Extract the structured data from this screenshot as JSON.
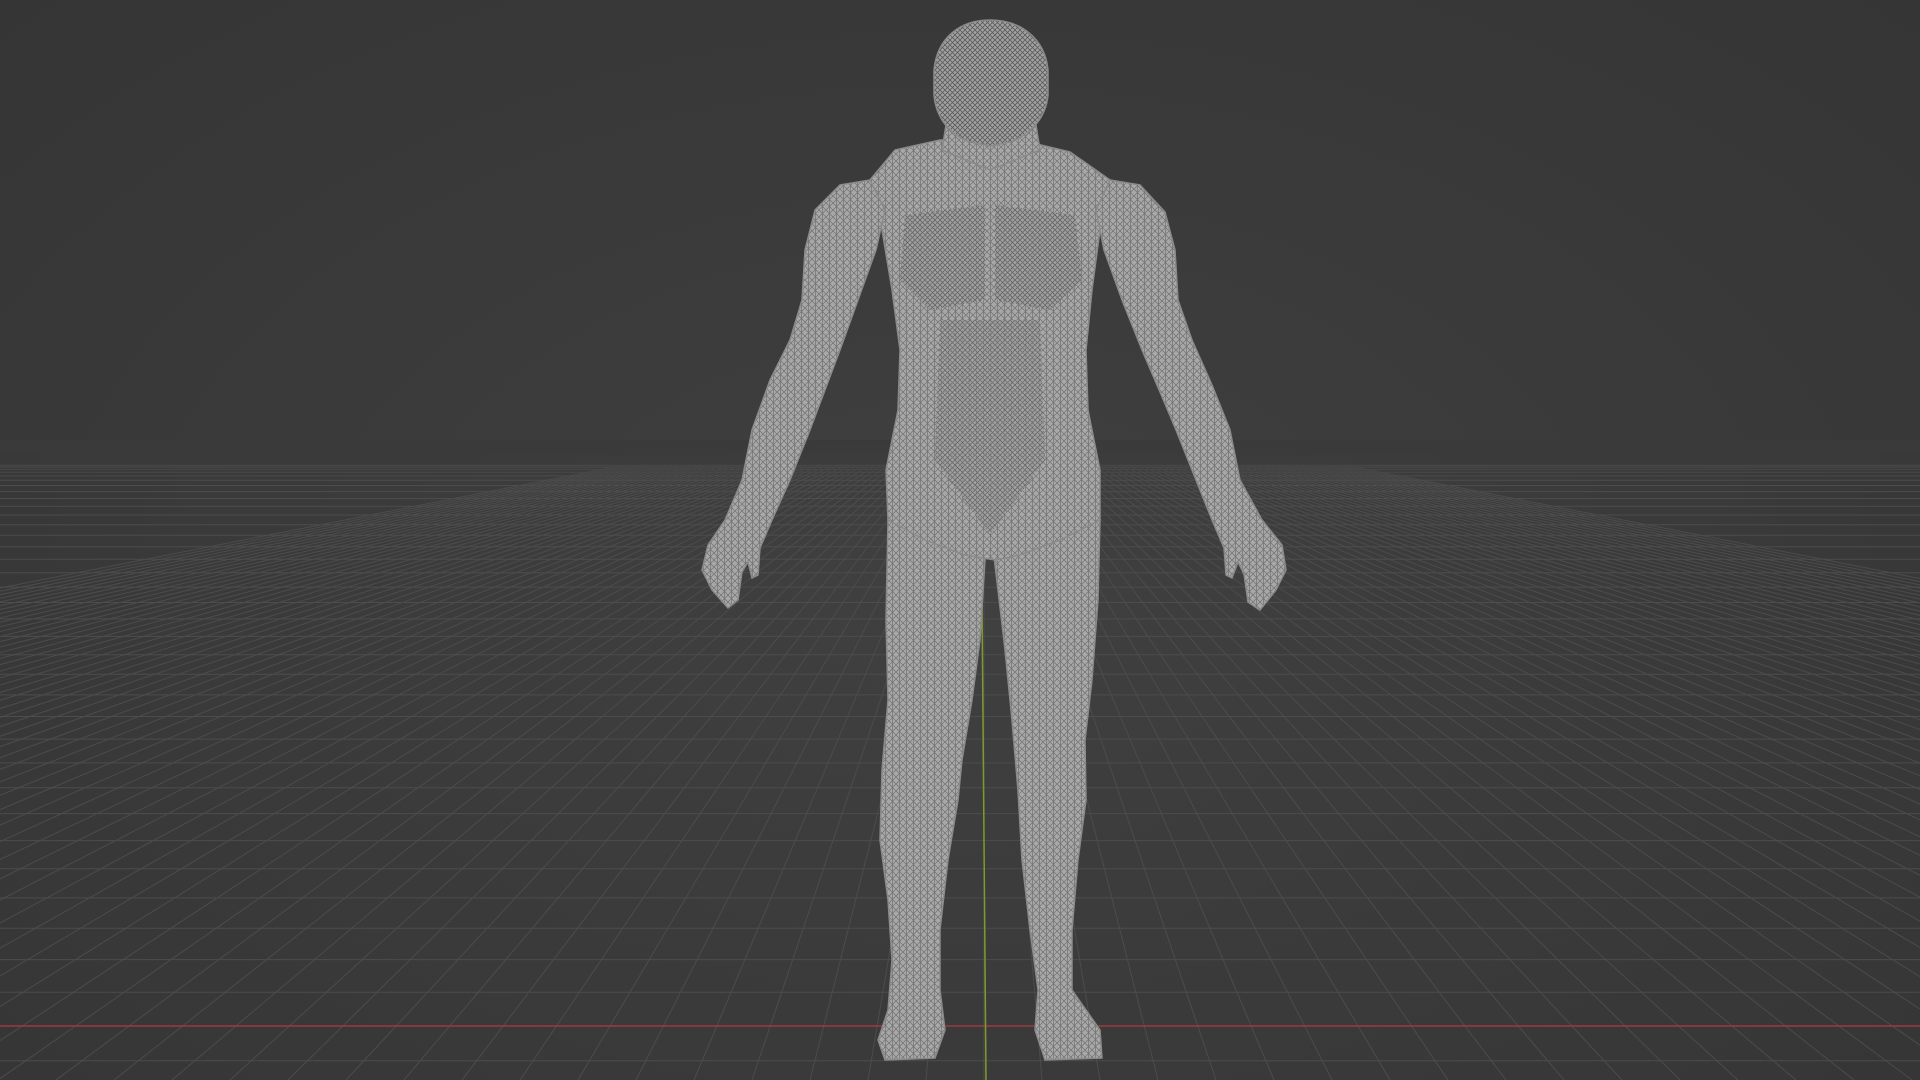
{
  "viewport": {
    "mode": "3d-viewport",
    "shading": "wireframe",
    "view": "front-perspective"
  },
  "scene": {
    "object": "humanoid-mesh",
    "colors": {
      "background": "#3a3a3a",
      "grid_line": "#4a4a4a",
      "x_axis": "#9a3a42",
      "y_axis": "#7f9a2c",
      "mesh_fill": "#a9a9a9",
      "mesh_wire": "#5a5a5a"
    }
  }
}
